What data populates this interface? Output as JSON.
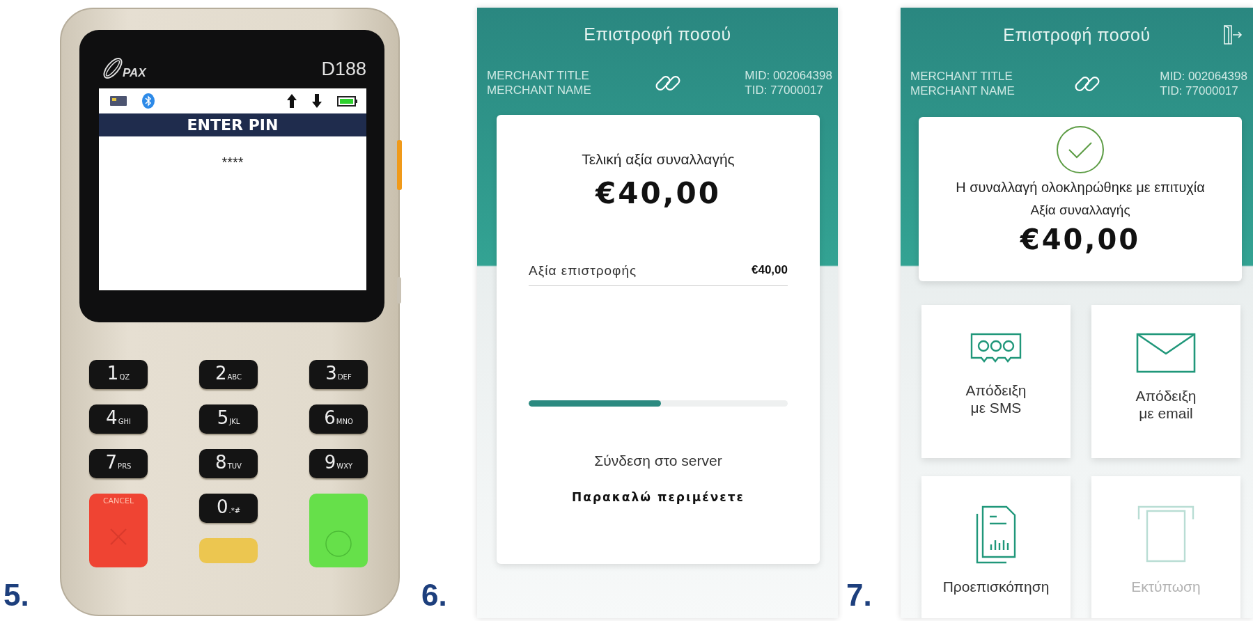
{
  "terminal": {
    "step_label": "5.",
    "logo": "PAX",
    "model": "D188",
    "screen_title": "ENTER PIN",
    "pin_entry": "****",
    "keys": [
      {
        "kind": "digit",
        "digit": "1",
        "letters": "QZ"
      },
      {
        "kind": "digit",
        "digit": "2",
        "letters": "ABC"
      },
      {
        "kind": "digit",
        "digit": "3",
        "letters": "DEF"
      },
      {
        "kind": "digit",
        "digit": "4",
        "letters": "GHI"
      },
      {
        "kind": "digit",
        "digit": "5",
        "letters": "JKL"
      },
      {
        "kind": "digit",
        "digit": "6",
        "letters": "MNO"
      },
      {
        "kind": "digit",
        "digit": "7",
        "letters": "PRS"
      },
      {
        "kind": "digit",
        "digit": "8",
        "letters": "TUV"
      },
      {
        "kind": "digit",
        "digit": "9",
        "letters": "WXY"
      },
      {
        "kind": "cancel",
        "label": "CANCEL"
      },
      {
        "kind": "digit",
        "digit": "0",
        "letters": ".*#"
      },
      {
        "kind": "enter"
      },
      {
        "kind": "clear"
      }
    ]
  },
  "refund_progress_screen": {
    "step_label": "6.",
    "title": "Επιστροφή ποσού",
    "merchant_title": "MERCHANT TITLE",
    "merchant_name": "MERCHANT NAME",
    "mid": "MID: 002064398",
    "tid": "TID: 77000017",
    "final_amount_label": "Τελική αξία συναλλαγής",
    "final_amount": "€40,00",
    "refund_label": "Αξία επιστροφής",
    "refund_value": "€40,00",
    "progress": {
      "level": 0.51
    },
    "status": "Σύνδεση στο server",
    "wait_message": "Παρακαλώ περιμένετε"
  },
  "refund_done_screen": {
    "step_label": "7.",
    "title": "Επιστροφή ποσού",
    "merchant_title": "MERCHANT TITLE",
    "merchant_name": "MERCHANT NAME",
    "mid": "MID: 002064398",
    "tid": "TID: 77000017",
    "success_message": "Η συναλλαγή ολοκληρώθηκε με επιτυχία",
    "amount_label": "Αξία συναλλαγής",
    "amount": "€40,00",
    "actions": [
      {
        "kind": "sms",
        "lines": [
          "Απόδειξη",
          "με SMS"
        ],
        "disabled": false
      },
      {
        "kind": "email",
        "lines": [
          "Απόδειξη",
          "με email"
        ],
        "disabled": false
      },
      {
        "kind": "preview",
        "lines": [
          "Προεπισκόπηση"
        ],
        "disabled": false
      },
      {
        "kind": "print",
        "lines": [
          "Εκτύπωση"
        ],
        "disabled": true
      }
    ]
  }
}
